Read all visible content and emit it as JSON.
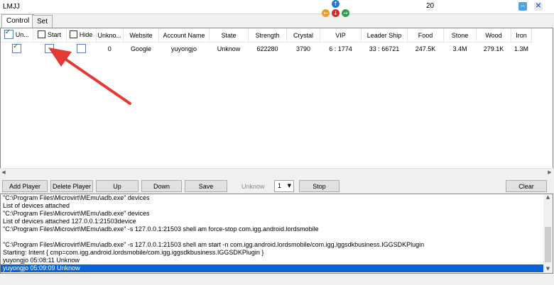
{
  "window": {
    "title": "LMJJ",
    "counter": "20",
    "minimize_icon": "minimize-icon",
    "close_glyph": "✕"
  },
  "nav_arrows": {
    "up": "↑",
    "left": "←",
    "down": "↓",
    "right": "→"
  },
  "tabs": [
    {
      "label": "Control"
    },
    {
      "label": "Set"
    }
  ],
  "grid": {
    "columns": [
      "Un...",
      "Start",
      "Hide",
      "Unkno...",
      "Website",
      "Account Name",
      "State",
      "Strength",
      "Crystal",
      "VIP",
      "Leader Ship",
      "Food",
      "Stone",
      "Wood",
      "Iron"
    ],
    "rows": [
      {
        "checked": true,
        "start": false,
        "hide": false,
        "unknown": "0",
        "website": "Google",
        "account": "yuyongjo",
        "state": "Unknow",
        "strength": "622280",
        "crystal": "3790",
        "vip": "6 : 1774",
        "leadership": "33 : 66721",
        "food": "247.5K",
        "stone": "3.4M",
        "wood": "279.1K",
        "iron": "1.3M"
      }
    ]
  },
  "buttons": {
    "add_player": "Add Player",
    "delete_player": "Delete Player",
    "up": "Up",
    "down": "Down",
    "save": "Save",
    "status": "Unknow",
    "count_value": "1",
    "stop": "Stop",
    "clear": "Clear"
  },
  "log_lines": [
    "\"C:\\Program Files\\Microvirt\\MEmu\\adb.exe\" devices",
    "List of devices attached",
    "\"C:\\Program Files\\Microvirt\\MEmu\\adb.exe\" devices",
    "List of devices attached 127.0.0.1:21503device",
    "\"C:\\Program Files\\Microvirt\\MEmu\\adb.exe\" -s 127.0.0.1:21503 shell am force-stop com.igg.android.lordsmobile",
    "",
    "\"C:\\Program Files\\Microvirt\\MEmu\\adb.exe\" -s 127.0.0.1:21503 shell am start -n com.igg.android.lordsmobile/com.igg.iggsdkbusiness.IGGSDKPlugin",
    "Starting: Intent { cmp=com.igg.android.lordsmobile/com.igg.iggsdkbusiness.IGGSDKPlugin }",
    "yuyongjo   05:08:11  Unknow",
    "yuyongjo   05:09:09  Unknow"
  ],
  "colors": {
    "selection": "#0a64d8",
    "annotation_arrow": "#e53935",
    "up_icon": "#1f7ad6",
    "down_icon": "#d42a1f",
    "left_icon": "#f59a1c",
    "right_icon": "#2aa14a"
  }
}
